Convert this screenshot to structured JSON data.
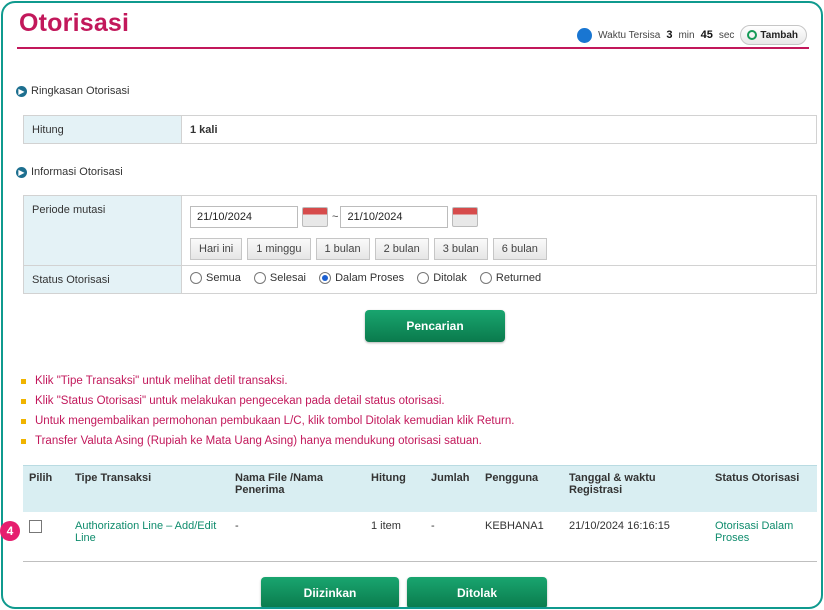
{
  "page": {
    "title": "Otorisasi"
  },
  "timer": {
    "prefix": "Waktu Tersisa",
    "minutes": "3",
    "min_unit": "min",
    "seconds": "45",
    "sec_unit": "sec",
    "add_label": "Tambah"
  },
  "summary": {
    "heading": "Ringkasan Otorisasi",
    "count_label": "Hitung",
    "count_value": "1 kali"
  },
  "info": {
    "heading": "Informasi Otorisasi",
    "period_label": "Periode mutasi",
    "date_from": "21/10/2024",
    "date_separator": "~",
    "date_to": "21/10/2024",
    "range_buttons": [
      "Hari ini",
      "1 minggu",
      "1 bulan",
      "2 bulan",
      "3 bulan",
      "6 bulan"
    ],
    "status_label": "Status Otorisasi",
    "status_options": [
      "Semua",
      "Selesai",
      "Dalam Proses",
      "Ditolak",
      "Returned"
    ],
    "status_selected": "Dalam Proses"
  },
  "search_button": "Pencarian",
  "notes": [
    "Klik \"Tipe Transaksi\" untuk melihat detil transaksi.",
    "Klik \"Status Otorisasi\" untuk melakukan pengecekan pada detail status otorisasi.",
    "Untuk mengembalikan permohonan pembukaan L/C, klik tombol Ditolak kemudian klik Return.",
    "Transfer Valuta Asing (Rupiah ke Mata Uang Asing) hanya mendukung otorisasi satuan."
  ],
  "table": {
    "headers": [
      "Pilih",
      "Tipe Transaksi",
      "Nama File /Nama Penerima",
      "Hitung",
      "Jumlah",
      "Pengguna",
      "Tanggal & waktu Registrasi",
      "Status Otorisasi"
    ],
    "rows": [
      {
        "type": "Authorization Line – Add/Edit Line",
        "name": "-",
        "count": "1 item",
        "amount": "-",
        "user": "KEBHANA1",
        "datetime": "21/10/2024 16:16:15",
        "status": "Otorisasi Dalam Proses"
      }
    ]
  },
  "annotation_badge": "4",
  "actions": {
    "approve": "Diizinkan",
    "reject": "Ditolak"
  },
  "colors": {
    "brand": "#c2185b",
    "accent_green": "#0a7a4c",
    "header_bg": "#d9eef2"
  }
}
